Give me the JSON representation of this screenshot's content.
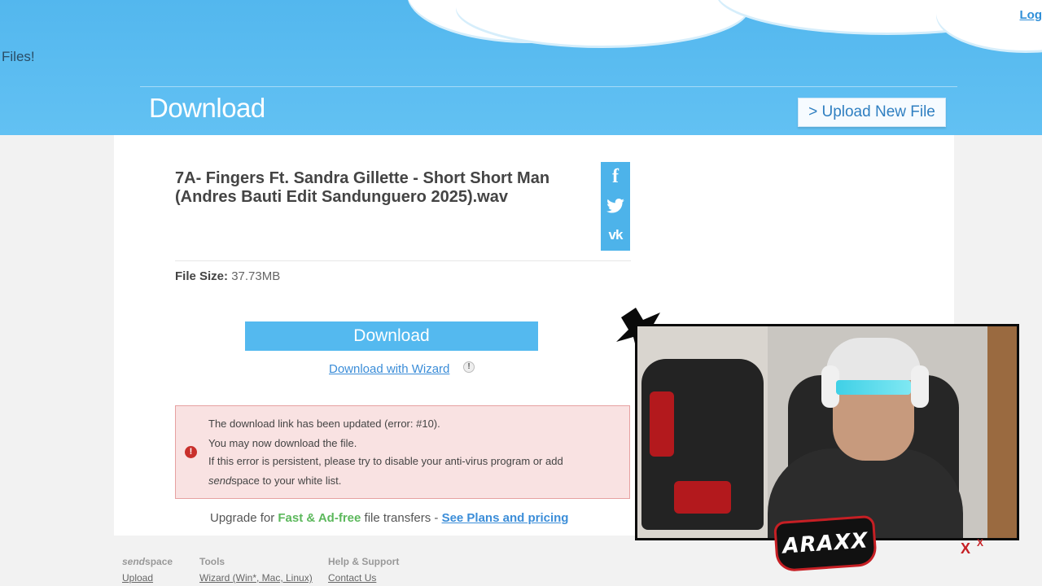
{
  "header": {
    "login_label": "Log",
    "files_text": "Files!",
    "title": "Download",
    "upload_new_file_label": "> Upload New File"
  },
  "file": {
    "name": "7A- Fingers Ft. Sandra Gillette - Short Short Man (Andres Bauti Edit Sandunguero 2025).wav",
    "size_label": "File Size:",
    "size_value": "37.73MB"
  },
  "social": {
    "facebook_icon": "f",
    "twitter_icon": "🐦",
    "vk_icon": "vk"
  },
  "actions": {
    "download_label": "Download",
    "wizard_label": "Download with Wizard",
    "wizard_info_icon": "!"
  },
  "error": {
    "icon": "!",
    "line1": "The download link has been updated (error: #10).",
    "line2": "You may now download the file.",
    "line3": "If this error is persistent, please try to disable your anti-virus program or add",
    "line4_brand": "send",
    "line4_rest": "space to your white list."
  },
  "upgrade": {
    "prefix": "Upgrade for ",
    "highlight": "Fast & Ad-free",
    "middle": " file transfers - ",
    "plans_link": "See Plans and pricing"
  },
  "footer": {
    "col1": {
      "brand_italic": "send",
      "brand_rest": "space",
      "link": "Upload"
    },
    "col2": {
      "head": "Tools",
      "link": "Wizard (Win*, Mac, Linux)"
    },
    "col3": {
      "head": "Help & Support",
      "link": "Contact Us"
    }
  },
  "overlay": {
    "streamer_logo": "ARAXX",
    "mark": "X"
  },
  "colors": {
    "sky": "#5bbcf0",
    "button": "#54b9ef",
    "link": "#3b8dd8",
    "error_bg": "#f9e2e2",
    "green": "#5cb85c"
  }
}
